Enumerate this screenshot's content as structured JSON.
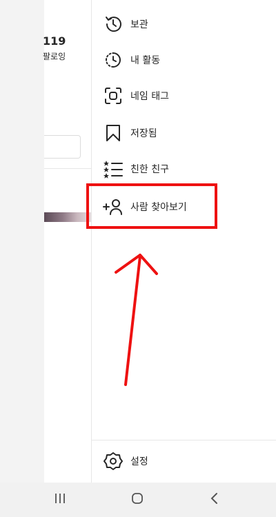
{
  "background_profile": {
    "count_fragment": "119",
    "label_fragment": "팔로잉"
  },
  "drawer": {
    "items": [
      {
        "label": "보관",
        "icon": "archive-history-icon"
      },
      {
        "label": "내 활동",
        "icon": "activity-clock-icon"
      },
      {
        "label": "네임 태그",
        "icon": "nametag-scan-icon"
      },
      {
        "label": "저장됨",
        "icon": "bookmark-icon"
      },
      {
        "label": "친한 친구",
        "icon": "close-friends-list-icon"
      },
      {
        "label": "사람 찾아보기",
        "icon": "discover-people-icon"
      }
    ],
    "settings_label": "설정",
    "settings_icon": "settings-gear-icon"
  },
  "annotation": {
    "highlight_color": "#ee1111",
    "highlighted_item": "사람 찾아보기"
  },
  "navbar": {
    "recent_icon": "recent-apps-icon",
    "home_icon": "home-icon",
    "back_icon": "back-icon"
  }
}
